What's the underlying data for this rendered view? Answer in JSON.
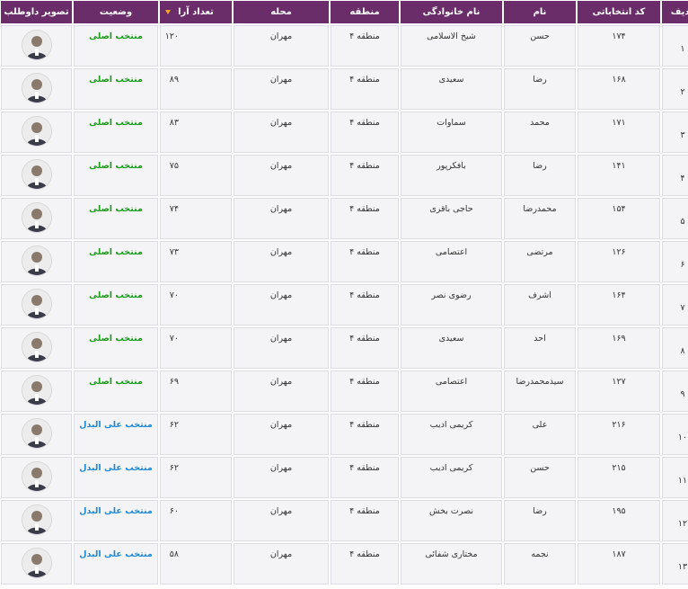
{
  "headers": {
    "row": "ردیف",
    "code": "کد انتخاباتی",
    "first_name": "نام",
    "last_name": "نام خانوادگی",
    "district": "منطقه",
    "locality": "محله",
    "votes": "تعداد آرا",
    "status": "وضعیت",
    "photo": "تصویر داوطلب"
  },
  "rows": [
    {
      "row": "۱",
      "code": "۱۷۴",
      "first_name": "حسن",
      "last_name": "شیخ الاسلامی",
      "district": "منطقه ۴",
      "locality": "مهران",
      "votes": "۱۲۰",
      "status": "منتخب اصلی",
      "status_type": "primary"
    },
    {
      "row": "۲",
      "code": "۱۶۸",
      "first_name": "رضا",
      "last_name": "سعیدی",
      "district": "منطقه ۴",
      "locality": "مهران",
      "votes": "۸۹",
      "status": "منتخب اصلی",
      "status_type": "primary"
    },
    {
      "row": "۳",
      "code": "۱۷۱",
      "first_name": "محمد",
      "last_name": "سماوات",
      "district": "منطقه ۴",
      "locality": "مهران",
      "votes": "۸۳",
      "status": "منتخب اصلی",
      "status_type": "primary"
    },
    {
      "row": "۴",
      "code": "۱۴۱",
      "first_name": "رضا",
      "last_name": "بافکرپور",
      "district": "منطقه ۴",
      "locality": "مهران",
      "votes": "۷۵",
      "status": "منتخب اصلی",
      "status_type": "primary"
    },
    {
      "row": "۵",
      "code": "۱۵۴",
      "first_name": "محمدرضا",
      "last_name": "حاجی باقری",
      "district": "منطقه ۴",
      "locality": "مهران",
      "votes": "۷۴",
      "status": "منتخب اصلی",
      "status_type": "primary"
    },
    {
      "row": "۶",
      "code": "۱۲۶",
      "first_name": "مرتضی",
      "last_name": "اعتصامی",
      "district": "منطقه ۴",
      "locality": "مهران",
      "votes": "۷۳",
      "status": "منتخب اصلی",
      "status_type": "primary"
    },
    {
      "row": "۷",
      "code": "۱۶۴",
      "first_name": "اشرف",
      "last_name": "رضوی نصر",
      "district": "منطقه ۴",
      "locality": "مهران",
      "votes": "۷۰",
      "status": "منتخب اصلی",
      "status_type": "primary"
    },
    {
      "row": "۸",
      "code": "۱۶۹",
      "first_name": "احد",
      "last_name": "سعیدی",
      "district": "منطقه ۴",
      "locality": "مهران",
      "votes": "۷۰",
      "status": "منتخب اصلی",
      "status_type": "primary"
    },
    {
      "row": "۹",
      "code": "۱۲۷",
      "first_name": "سیدمحمدرضا",
      "last_name": "اعتصامی",
      "district": "منطقه ۴",
      "locality": "مهران",
      "votes": "۶۹",
      "status": "منتخب اصلی",
      "status_type": "primary"
    },
    {
      "row": "۱۰",
      "code": "۲۱۶",
      "first_name": "علی",
      "last_name": "کریمی ادیب",
      "district": "منطقه ۴",
      "locality": "مهران",
      "votes": "۶۲",
      "status": "منتخب علی البدل",
      "status_type": "alternate"
    },
    {
      "row": "۱۱",
      "code": "۲۱۵",
      "first_name": "حسن",
      "last_name": "کریمی ادیب",
      "district": "منطقه ۴",
      "locality": "مهران",
      "votes": "۶۲",
      "status": "منتخب علی البدل",
      "status_type": "alternate"
    },
    {
      "row": "۱۲",
      "code": "۱۹۵",
      "first_name": "رضا",
      "last_name": "نصرت بخش",
      "district": "منطقه ۴",
      "locality": "مهران",
      "votes": "۶۰",
      "status": "منتخب علی البدل",
      "status_type": "alternate"
    },
    {
      "row": "۱۳",
      "code": "۱۸۷",
      "first_name": "نجمه",
      "last_name": "مختاری شفائی",
      "district": "منطقه ۴",
      "locality": "مهران",
      "votes": "۵۸",
      "status": "منتخب علی البدل",
      "status_type": "alternate"
    }
  ],
  "colors": {
    "header_bg": "#6b2d6a",
    "primary_status": "#1a9b1a",
    "alternate_status": "#1e88d6",
    "sort_icon": "#f6a623"
  }
}
